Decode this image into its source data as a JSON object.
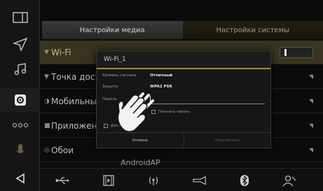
{
  "tabs": {
    "media": "Настройки медиа",
    "system": "Настройки системы"
  },
  "settings": [
    {
      "label": "Wi-Fi",
      "selected": true
    },
    {
      "label": "Точка доступа"
    },
    {
      "label": "Мобильные данные"
    },
    {
      "label": "Приложения"
    },
    {
      "label": "Обои"
    }
  ],
  "android_ap": "AndroidAP",
  "dialog": {
    "title": "Wi-Fi_1",
    "signal_label": "Уровень сигнала",
    "signal_value": "Отличный",
    "security_label": "Защита",
    "security_value": "WPA2 PSK",
    "password_label": "Пароль",
    "password_value": "",
    "show_password_label": "Показать пароль",
    "advanced_label": "Доп...",
    "cancel_label": "Отмена",
    "connect_label": "Подключить"
  },
  "sidebar_icons": [
    "split-screen-icon",
    "navigation-icon",
    "music-icon",
    "settings-icon",
    "apps-icon",
    "voice-icon",
    "back-icon"
  ],
  "bottom_icons": [
    "usb-icon",
    "video-icon",
    "radio-icon",
    "trumpet-icon",
    "bluetooth-icon",
    "user-icon"
  ],
  "colors": {
    "accent": "#a08a4a",
    "wifi_row": "#3a3322",
    "background": "#0b0b0b"
  }
}
